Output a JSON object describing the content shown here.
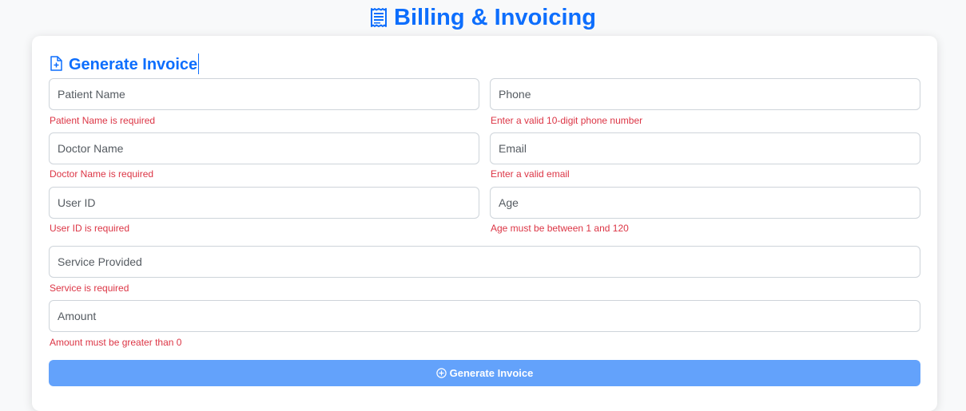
{
  "header": {
    "title": "Billing & Invoicing",
    "icon": "receipt-icon"
  },
  "form": {
    "title": "Generate Invoice",
    "title_icon": "file-plus-icon",
    "fields": {
      "patient_name": {
        "placeholder": "Patient Name",
        "value": "",
        "error": "Patient Name is required"
      },
      "phone": {
        "placeholder": "Phone",
        "value": "",
        "error": "Enter a valid 10-digit phone number"
      },
      "doctor_name": {
        "placeholder": "Doctor Name",
        "value": "",
        "error": "Doctor Name is required"
      },
      "email": {
        "placeholder": "Email",
        "value": "",
        "error": "Enter a valid email"
      },
      "user_id": {
        "placeholder": "User ID",
        "value": "",
        "error": "User ID is required"
      },
      "age": {
        "placeholder": "Age",
        "value": "",
        "error": "Age must be between 1 and 120"
      },
      "service": {
        "placeholder": "Service Provided",
        "value": "",
        "error": "Service is required"
      },
      "amount": {
        "placeholder": "Amount",
        "value": "",
        "error": "Amount must be greater than 0"
      }
    },
    "submit_label": "Generate Invoice",
    "submit_icon": "plus-circle-icon"
  },
  "colors": {
    "primary": "#0d6efd",
    "button": "#63a2fb",
    "error": "#dc3545",
    "border": "#ced4da"
  }
}
